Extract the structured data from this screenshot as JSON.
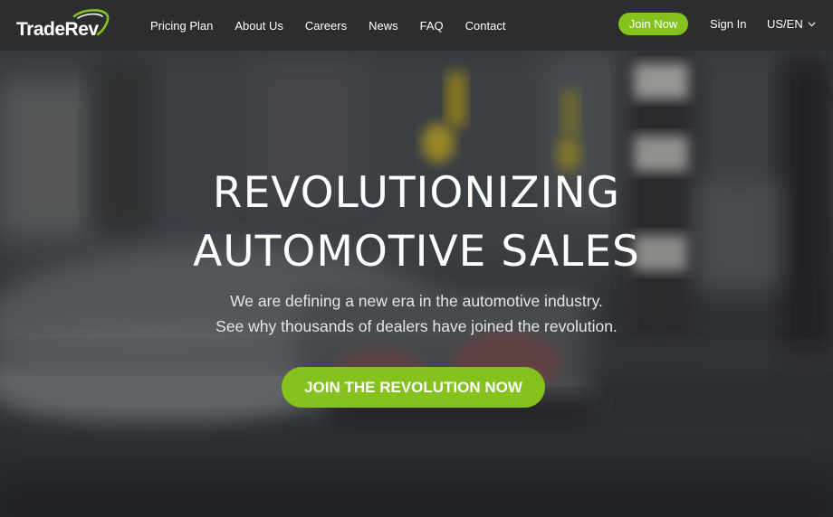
{
  "navbar": {
    "logo_text": "TradeRev",
    "links": [
      {
        "label": "Pricing Plan"
      },
      {
        "label": "About Us"
      },
      {
        "label": "Careers"
      },
      {
        "label": "News"
      },
      {
        "label": "FAQ"
      },
      {
        "label": "Contact"
      }
    ],
    "join_label": "Join Now",
    "signin_label": "Sign In",
    "locale_label": "US/EN",
    "locale_icon": "chevron-down-icon"
  },
  "hero": {
    "headline_line1": "REVOLUTIONIZING",
    "headline_line2": "AUTOMOTIVE SALES",
    "subtext_line1": "We are defining a new era in the automotive industry.",
    "subtext_line2": "See why thousands of dealers have joined the revolution.",
    "cta_label": "JOIN THE REVOLUTION NOW"
  },
  "colors": {
    "accent_green": "#84c21c",
    "navbar_bg": "#2b2d2f",
    "text_white": "#ffffff"
  }
}
